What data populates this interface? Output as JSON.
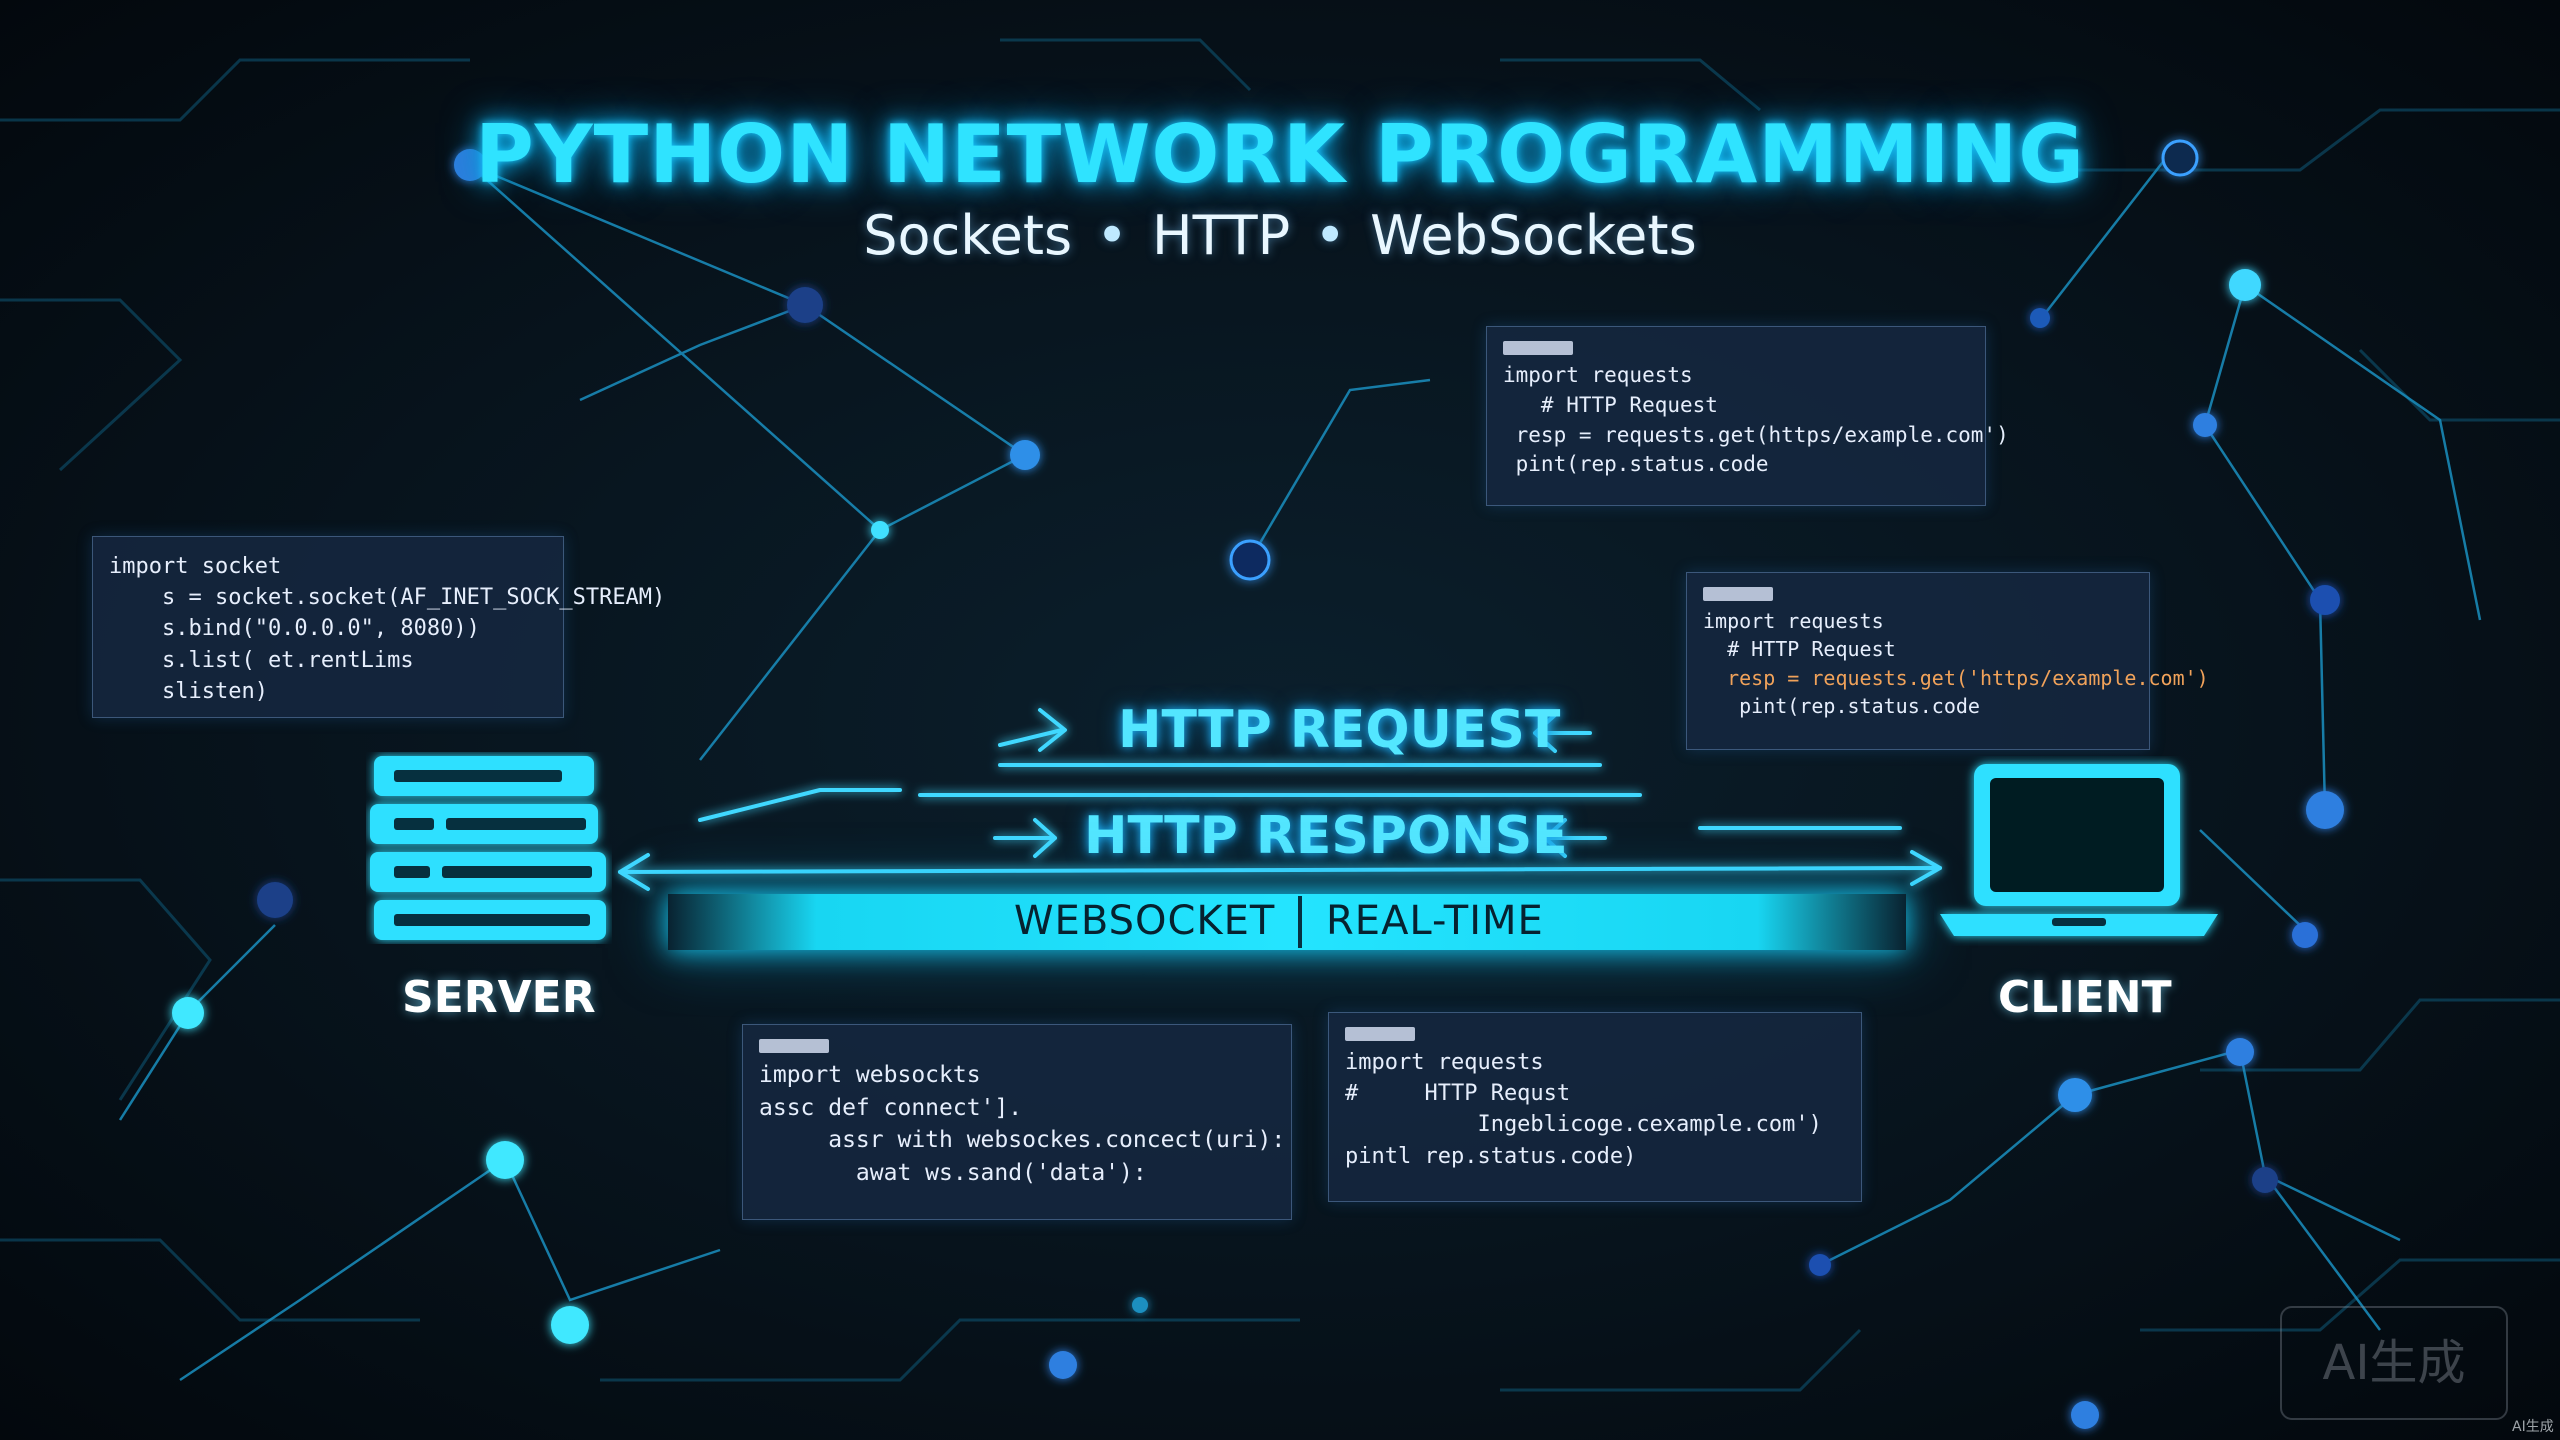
{
  "title": "PYTHON NETWORK PROGRAMMING",
  "subtitle": {
    "part1": "Sockets",
    "part2": "HTTP",
    "part3": "WebSockets",
    "separator": "•"
  },
  "panels": {
    "socket_server": [
      "import socket",
      "    s = socket.socket(AF_INET_SOCK_STREAM)",
      "    s.bind(\"0.0.0.0\", 8080))",
      "    s.list( et.rentLims",
      "    slisten)"
    ],
    "http_top": [
      "import requests",
      "   # HTTP Request",
      " resp = requests.get(https/example.com')",
      " pint(rep.status.code"
    ],
    "http_right": [
      "import requests",
      "  # HTTP Request",
      "  resp = requests.get('https/example.com')",
      "   pint(rep.status.code"
    ],
    "websocket": [
      "import websockts",
      "assc def connect'].",
      "     assr with websockes.concect(uri):",
      "       awat ws.sand('data'):"
    ],
    "http_bottom": [
      "import requests",
      "#     HTTP Requst",
      "          Ingeblicoge.cexample.com')",
      "pintl rep.status.code)"
    ]
  },
  "flow": {
    "request_label": "HTTP REQUEST",
    "response_label": "HTTP RESPONSE",
    "websocket_label": "WEBSOCKET",
    "realtime_label": "REAL-TIME"
  },
  "devices": {
    "server_label": "SERVER",
    "client_label": "CLIENT"
  },
  "watermark": {
    "text": "AI生成",
    "corner": "AI生成"
  },
  "colors": {
    "neon_cyan": "#24e4ff",
    "node_blue": "#2f7fe0",
    "background": "#07131c",
    "code_accent": "#f0a25a"
  }
}
